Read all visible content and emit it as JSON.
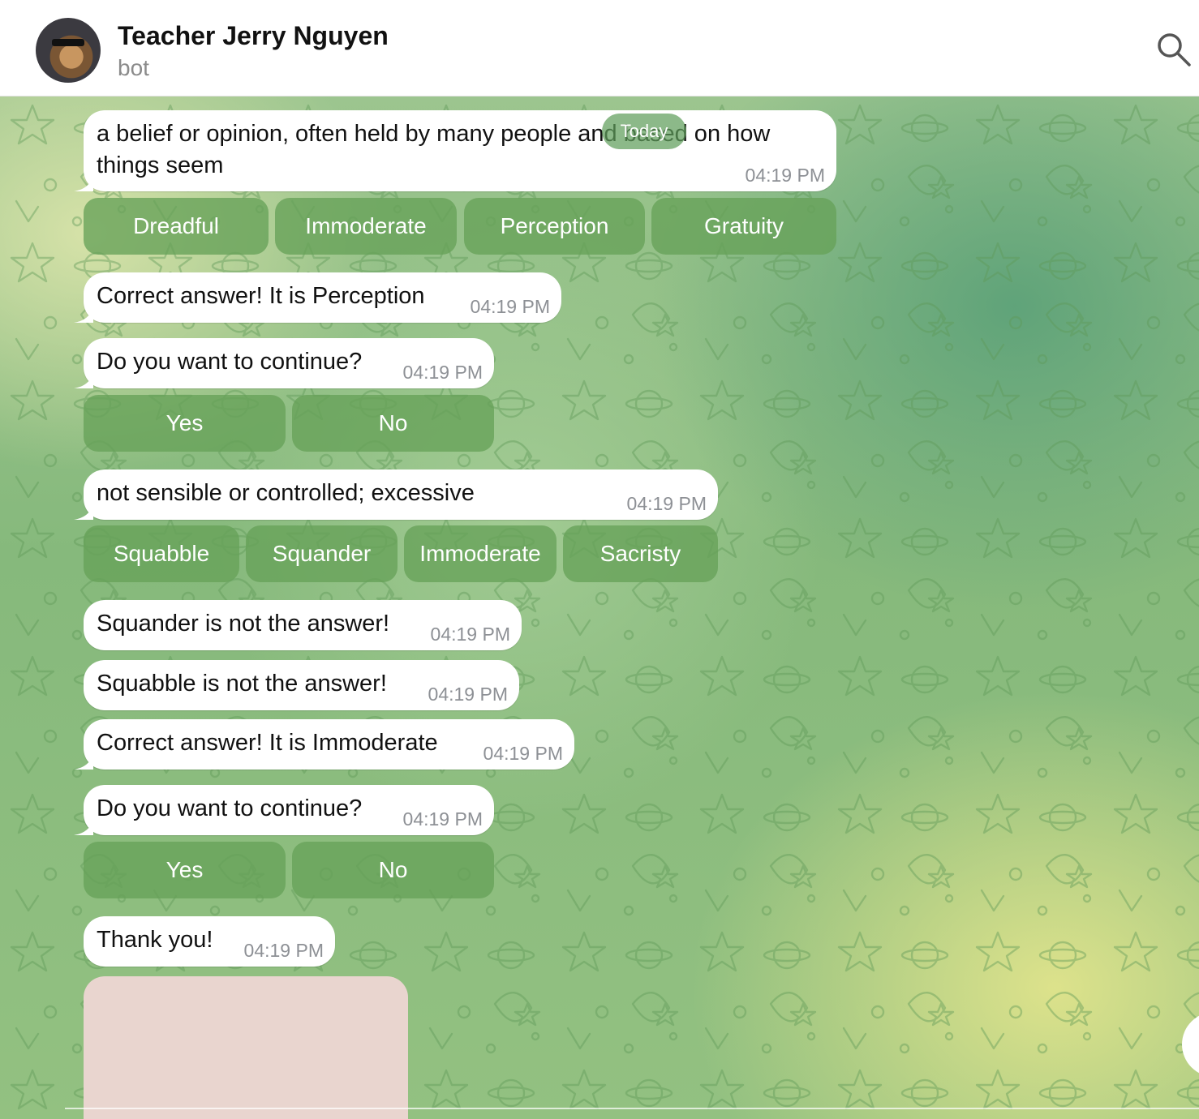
{
  "header": {
    "title": "Teacher Jerry Nguyen",
    "subtitle": "bot"
  },
  "date_pill": "Today",
  "messages": [
    {
      "text1": "a belief or opinion, often held by many people and based on how",
      "text2": "things seem",
      "time": "04:19 PM"
    },
    {
      "text": "Correct answer! It is Perception",
      "time": "04:19 PM"
    },
    {
      "text": "Do you want to continue?",
      "time": "04:19 PM"
    },
    {
      "text": "not sensible or controlled; excessive",
      "time": "04:19 PM"
    },
    {
      "text": "Squander is not the answer!",
      "time": "04:19 PM"
    },
    {
      "text": "Squabble is not the answer!",
      "time": "04:19 PM"
    },
    {
      "text": "Correct answer! It is Immoderate",
      "time": "04:19 PM"
    },
    {
      "text": "Do you want to continue?",
      "time": "04:19 PM"
    },
    {
      "text": "Thank you!",
      "time": "04:19 PM"
    }
  ],
  "keyboards": {
    "quiz1": [
      "Dreadful",
      "Immoderate",
      "Perception",
      "Gratuity"
    ],
    "continue1": [
      "Yes",
      "No"
    ],
    "quiz2": [
      "Squabble",
      "Squander",
      "Immoderate",
      "Sacristy"
    ],
    "continue2": [
      "Yes",
      "No"
    ]
  },
  "icons": {
    "search": "search-icon",
    "avatar": "bot-avatar-cat-with-sunglasses"
  },
  "colors": {
    "keyboard_button": "#67a258",
    "bubble": "#ffffff",
    "time": "#8d9095"
  }
}
